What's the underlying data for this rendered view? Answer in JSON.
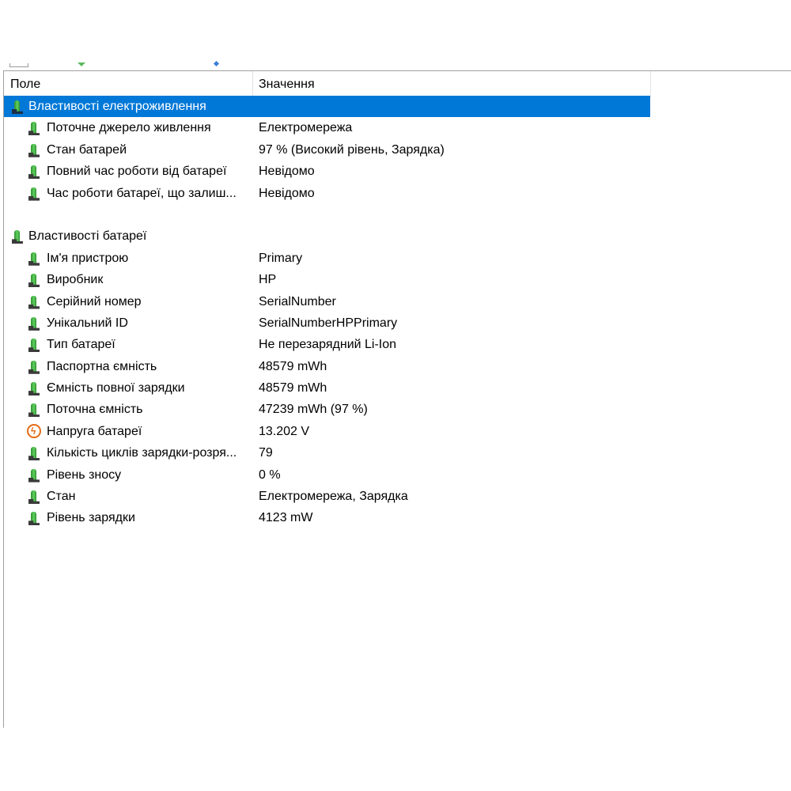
{
  "columns": {
    "field": "Поле",
    "value": "Значення"
  },
  "groups": [
    {
      "label": "Властивості електроживлення",
      "selected": true,
      "icon": "battery-icon",
      "items": [
        {
          "label": "Поточне джерело живлення",
          "value": "Електромережа",
          "icon": "battery-icon"
        },
        {
          "label": "Стан батарей",
          "value": "97 % (Високий рівень, Зарядка)",
          "icon": "battery-icon"
        },
        {
          "label": "Повний час роботи від батареї",
          "value": "Невідомо",
          "icon": "battery-icon"
        },
        {
          "label": "Час роботи батареї, що залиш...",
          "value": "Невідомо",
          "icon": "battery-icon"
        }
      ]
    },
    {
      "label": "Властивості батареї",
      "selected": false,
      "icon": "battery-icon",
      "items": [
        {
          "label": "Ім'я пристрою",
          "value": "Primary",
          "icon": "battery-icon"
        },
        {
          "label": "Виробник",
          "value": "HP",
          "icon": "battery-icon"
        },
        {
          "label": "Серійний номер",
          "value": "SerialNumber",
          "icon": "battery-icon"
        },
        {
          "label": "Унікальний ID",
          "value": "SerialNumberHPPrimary",
          "icon": "battery-icon"
        },
        {
          "label": "Тип батареї",
          "value": "Не перезарядний Li-Ion",
          "icon": "battery-icon"
        },
        {
          "label": "Паспортна ємність",
          "value": "48579 mWh",
          "icon": "battery-icon"
        },
        {
          "label": "Ємність повної зарядки",
          "value": "48579 mWh",
          "icon": "battery-icon"
        },
        {
          "label": "Поточна ємність",
          "value": "47239 mWh  (97 %)",
          "icon": "battery-icon"
        },
        {
          "label": "Напруга батареї",
          "value": "13.202 V",
          "icon": "power-icon"
        },
        {
          "label": "Кількість циклів зарядки-розря...",
          "value": "79",
          "icon": "battery-icon"
        },
        {
          "label": "Рівень зносу",
          "value": "0 %",
          "icon": "battery-icon"
        },
        {
          "label": "Стан",
          "value": "Електромережа, Зарядка",
          "icon": "battery-icon"
        },
        {
          "label": "Рівень зарядки",
          "value": "4123 mW",
          "icon": "battery-icon"
        }
      ]
    }
  ],
  "colors": {
    "selection": "#0078d7",
    "battery": "#3cb043",
    "power": "#e46b17"
  }
}
